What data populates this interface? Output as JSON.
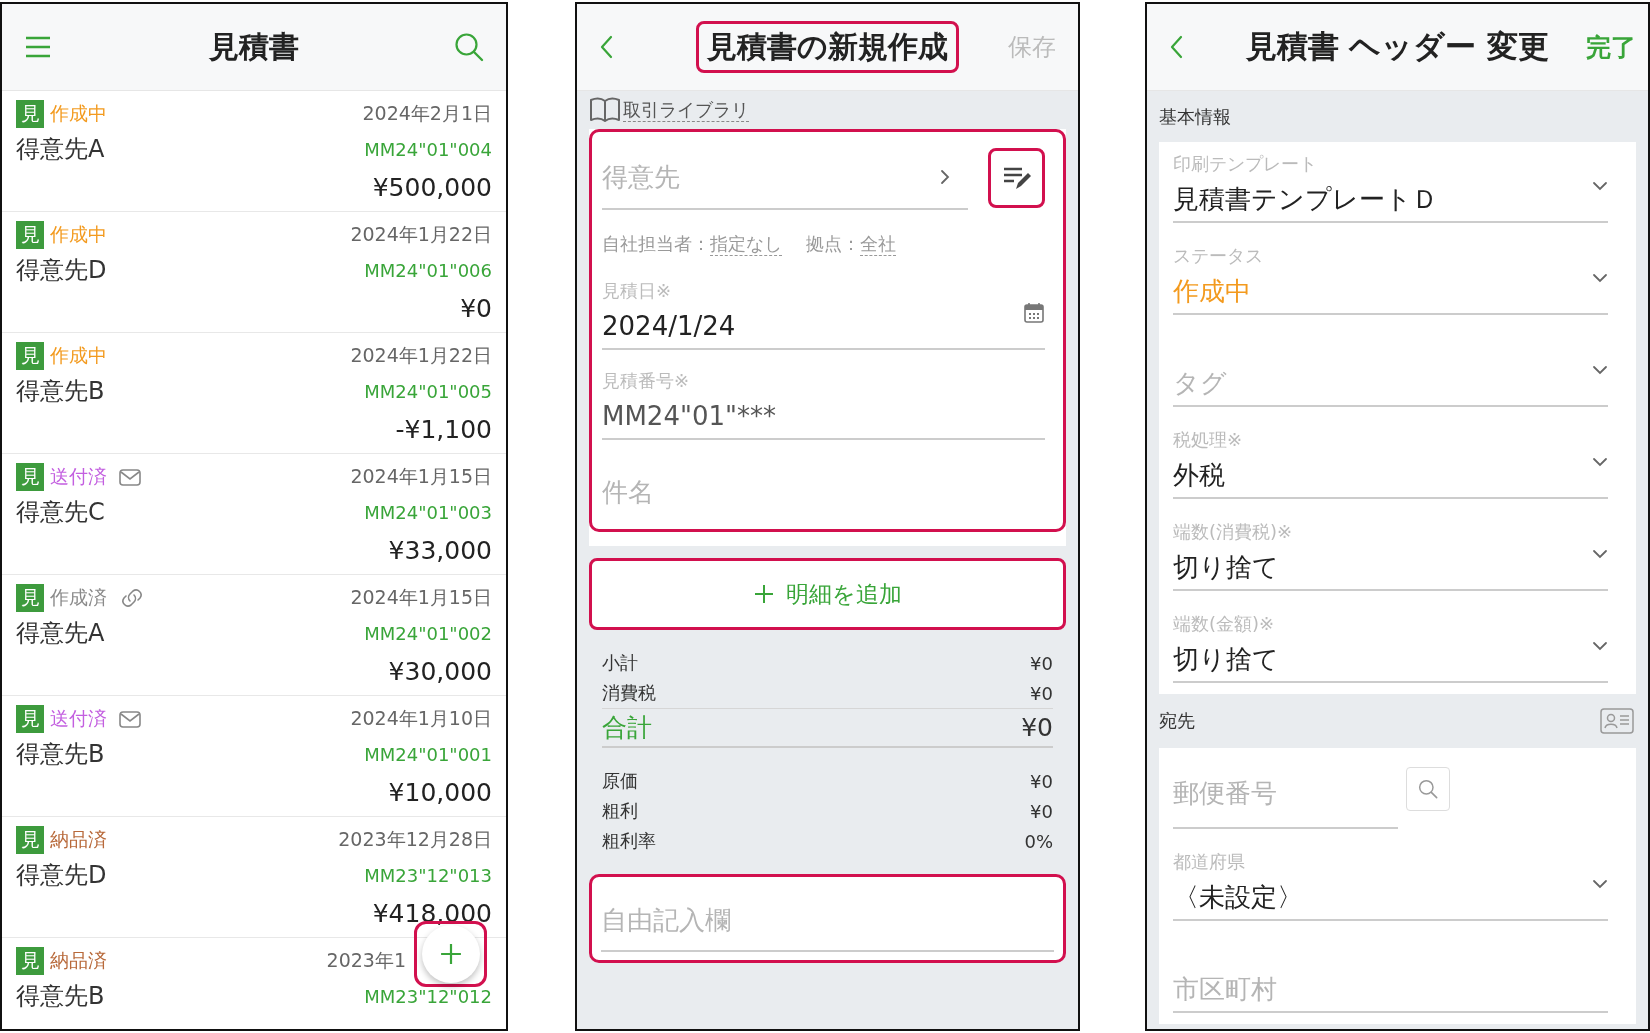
{
  "list_screen": {
    "title": "見積書",
    "items": [
      {
        "kind": "plain",
        "badge": "見",
        "status": "作成中",
        "color": "#f39a1e",
        "date": "2024年2月1日",
        "customer": "得意先A",
        "number": "MM24\"01\"004",
        "amount": "¥500,000"
      },
      {
        "kind": "plain",
        "badge": "見",
        "status": "作成中",
        "color": "#f39a1e",
        "date": "2024年1月22日",
        "customer": "得意先D",
        "number": "MM24\"01\"006",
        "amount": "¥0"
      },
      {
        "kind": "plain",
        "badge": "見",
        "status": "作成中",
        "color": "#f39a1e",
        "date": "2024年1月22日",
        "customer": "得意先B",
        "number": "MM24\"01\"005",
        "amount": "-¥1,100"
      },
      {
        "kind": "mail",
        "badge": "見",
        "status": "送付済",
        "color": "#c35fe0",
        "date": "2024年1月15日",
        "customer": "得意先C",
        "number": "MM24\"01\"003",
        "amount": "¥33,000"
      },
      {
        "kind": "link",
        "badge": "見",
        "status": "作成済",
        "color": "#8a8a8a",
        "date": "2024年1月15日",
        "customer": "得意先A",
        "number": "MM24\"01\"002",
        "amount": "¥30,000"
      },
      {
        "kind": "mail",
        "badge": "見",
        "status": "送付済",
        "color": "#c35fe0",
        "date": "2024年1月10日",
        "customer": "得意先B",
        "number": "MM24\"01\"001",
        "amount": "¥10,000"
      },
      {
        "kind": "plain",
        "badge": "見",
        "status": "納品済",
        "color": "#b8693a",
        "date": "2023年12月28日",
        "customer": "得意先D",
        "number": "MM23\"12\"013",
        "amount": "¥418,000"
      },
      {
        "kind": "plain",
        "badge": "見",
        "status": "納品済",
        "color": "#b8693a",
        "date": "2023年1",
        "customer": "得意先B",
        "number": "MM23\"12\"012"
      }
    ],
    "fab": {
      "highlighted": true
    }
  },
  "new_screen": {
    "title": {
      "text": "見積書の新規作成",
      "highlighted": true
    },
    "save": {
      "label": "保存",
      "disabled": true
    },
    "library_link": "取引ライブラリ",
    "form": {
      "highlighted": true,
      "customer": {
        "placeholder": "得意先"
      },
      "edit_button": {
        "highlighted": true
      },
      "staff_label": "自社担当者：",
      "staff_value": "指定なし",
      "branch_label": "拠点：",
      "branch_value": "全社",
      "date": {
        "label": "見積日※",
        "value": "2024/1/24"
      },
      "number": {
        "label": "見積番号※",
        "value": "MM24\"01\"***"
      },
      "subject": {
        "placeholder": "件名"
      }
    },
    "add_line": {
      "label": "明細を追加",
      "highlighted": true
    },
    "totals": [
      {
        "kind": "normal",
        "label": "小計",
        "value": "¥0"
      },
      {
        "kind": "normal",
        "label": "消費税",
        "value": "¥0"
      },
      {
        "kind": "total",
        "label": "合計",
        "value": "¥0"
      }
    ],
    "margins": [
      {
        "label": "原価",
        "value": "¥0"
      },
      {
        "label": "粗利",
        "value": "¥0"
      },
      {
        "label": "粗利率",
        "value": "0%"
      }
    ],
    "notes": {
      "placeholder": "自由記入欄",
      "highlighted": true
    }
  },
  "header_screen": {
    "title": "見積書 ヘッダー 変更",
    "done": "完了",
    "sections": [
      {
        "kind": "plain",
        "title": "基本情報",
        "fields": [
          {
            "kind": "select",
            "label": "印刷テンプレート",
            "value": "見積書テンプレートＤ"
          },
          {
            "kind": "select",
            "label": "ステータス",
            "value": "作成中",
            "color": "#f39a1e"
          },
          {
            "kind": "select",
            "placeholder": "タグ"
          },
          {
            "kind": "select",
            "label": "税処理※",
            "value": "外税"
          },
          {
            "kind": "select",
            "label": "端数(消費税)※",
            "value": "切り捨て"
          },
          {
            "kind": "select",
            "label": "端数(金額)※",
            "value": "切り捨て"
          }
        ]
      },
      {
        "kind": "contact",
        "title": "宛先",
        "fields": [
          {
            "kind": "zip",
            "placeholder": "郵便番号"
          },
          {
            "kind": "select",
            "label": "都道府県",
            "value": "〈未設定〉"
          },
          {
            "kind": "text",
            "placeholder": "市区町村"
          }
        ]
      }
    ]
  }
}
